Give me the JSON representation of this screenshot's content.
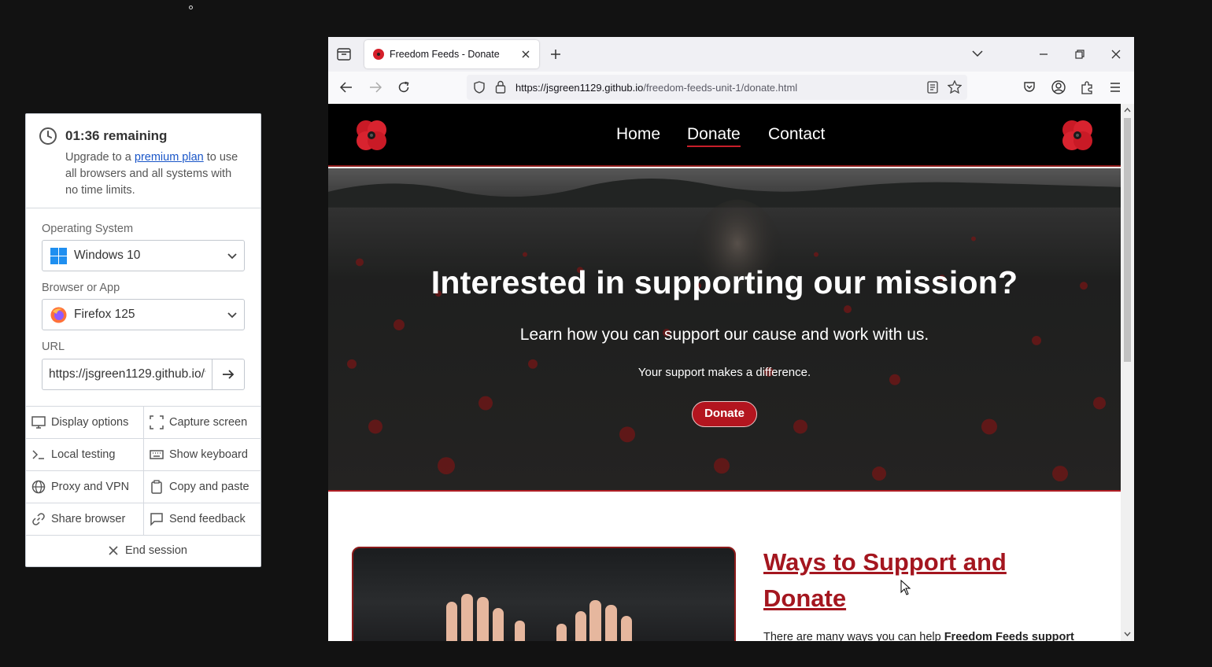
{
  "panel": {
    "timer_title": "01:36 remaining",
    "timer_text_before": "Upgrade to a ",
    "timer_link": "premium plan",
    "timer_text_after": " to use all browsers and all systems with no time limits.",
    "os_label": "Operating System",
    "os_value": "Windows 10",
    "browser_label": "Browser or App",
    "browser_value": "Firefox 125",
    "url_label": "URL",
    "url_value": "https://jsgreen1129.github.io/freedom-feeds-unit-1/donate.html",
    "actions": {
      "display_options": "Display options",
      "capture_screen": "Capture screen",
      "local_testing": "Local testing",
      "show_keyboard": "Show keyboard",
      "proxy_vpn": "Proxy and VPN",
      "copy_paste": "Copy and paste",
      "share_browser": "Share browser",
      "send_feedback": "Send feedback"
    },
    "end_session": "End session"
  },
  "browser": {
    "tab_title": "Freedom Feeds - Donate",
    "url_host": "https://jsgreen1129.github.io",
    "url_path": "/freedom-feeds-unit-1/donate.html"
  },
  "site": {
    "nav": {
      "home": "Home",
      "donate": "Donate",
      "contact": "Contact"
    },
    "hero_title": "Interested in supporting our mission?",
    "hero_subtitle": "Learn how you can support our cause and work with us.",
    "hero_small": "Your support makes a difference.",
    "hero_button": "Donate",
    "section_title": "Ways to Support and Donate",
    "section_text_start": "There are many ways you can help ",
    "section_text_bold": "Freedom Feeds support"
  },
  "colors": {
    "accent_red": "#b3151f",
    "link_blue": "#1a56c8",
    "header_black": "#000000"
  }
}
